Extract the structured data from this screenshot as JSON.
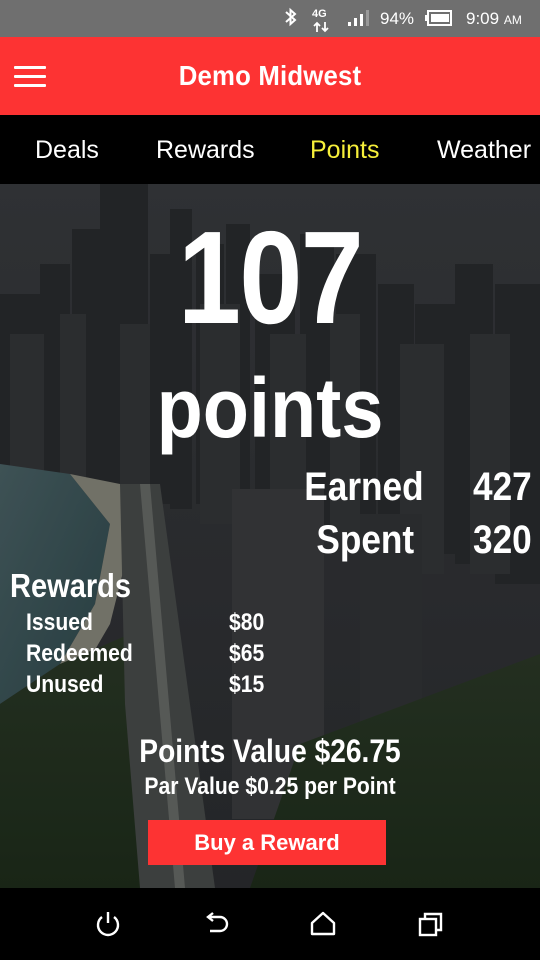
{
  "status_bar": {
    "network_label": "4G",
    "battery_percent": "94%",
    "time": "9:09",
    "time_suffix": "AM",
    "icons": [
      "bluetooth-icon",
      "lte-icon",
      "signal-icon",
      "battery-icon"
    ]
  },
  "app_bar": {
    "title": "Demo Midwest",
    "menu_icon": "hamburger-menu-icon"
  },
  "tabs": [
    {
      "label": "Deals",
      "active": false
    },
    {
      "label": "Rewards",
      "active": false
    },
    {
      "label": "Points",
      "active": true
    },
    {
      "label": "Weather",
      "active": false
    }
  ],
  "points": {
    "total": "107",
    "unit_label": "points",
    "earned_label": "Earned",
    "earned_value": "427",
    "spent_label": "Spent",
    "spent_value": "320"
  },
  "rewards": {
    "heading": "Rewards",
    "rows": [
      {
        "label": "Issued",
        "value": "$80"
      },
      {
        "label": "Redeemed",
        "value": "$65"
      },
      {
        "label": "Unused",
        "value": "$15"
      }
    ]
  },
  "values": {
    "points_value": "Points Value $26.75",
    "par_value": "Par Value $0.25 per Point"
  },
  "buy_button": {
    "label": "Buy a Reward"
  },
  "colors": {
    "accent_red": "#fd3333",
    "active_tab_yellow": "#f6ef3a",
    "status_bar_gray": "#6f6f6f",
    "tab_bar_black": "#000000"
  },
  "nav_bar": {
    "icons": [
      "power-icon",
      "back-icon",
      "home-icon",
      "recent-apps-icon"
    ]
  }
}
